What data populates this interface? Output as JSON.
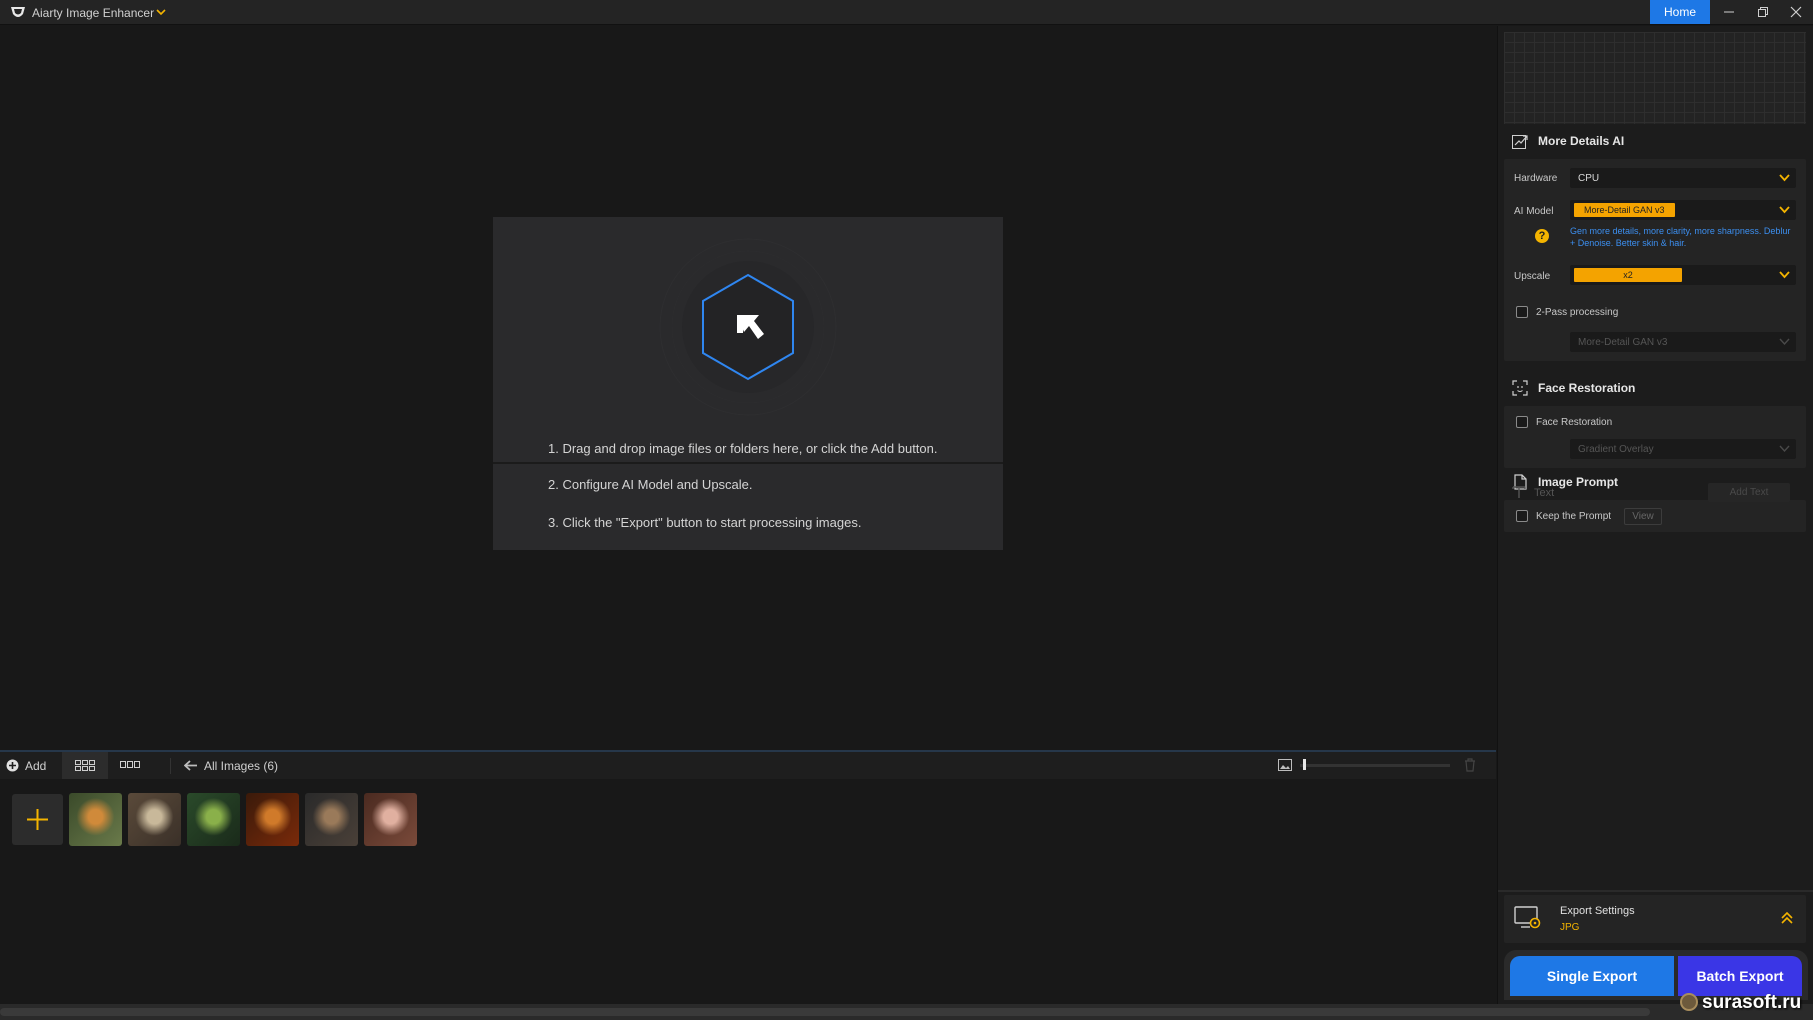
{
  "app": {
    "title": "Aiarty Image Enhancer",
    "home_label": "Home"
  },
  "dropzone": {
    "steps": [
      "1. Drag and drop image files or folders here, or click the Add button.",
      "2. Configure AI Model and Upscale.",
      "3. Click the \"Export\" button to start processing images."
    ]
  },
  "toolbar": {
    "add_label": "Add",
    "all_images_label": "All Images (6)",
    "thumbnail_size": 0.02
  },
  "thumbnails": [
    {
      "name": "tiger",
      "colors": [
        "#3a4a2a",
        "#d08a3a",
        "#6a7a4a"
      ]
    },
    {
      "name": "owl",
      "colors": [
        "#5a4a3a",
        "#c8b89a",
        "#3a3028"
      ]
    },
    {
      "name": "frog-forest",
      "colors": [
        "#2a4a2a",
        "#8ab04a",
        "#1a2a1a"
      ]
    },
    {
      "name": "burger",
      "colors": [
        "#3a1a0a",
        "#d07a2a",
        "#7a2a0a"
      ]
    },
    {
      "name": "dog-armor",
      "colors": [
        "#2a2a2a",
        "#9a7a5a",
        "#4a4038"
      ]
    },
    {
      "name": "woman-portrait",
      "colors": [
        "#4a2a20",
        "#e0b0a0",
        "#7a4a3a"
      ]
    }
  ],
  "panel": {
    "more_details": {
      "title": "More Details AI",
      "hardware_label": "Hardware",
      "hardware_value": "CPU",
      "ai_model_label": "AI Model",
      "ai_model_value": "More-Detail GAN  v3",
      "ai_model_description": "Gen more details, more clarity, more sharpness. Deblur + Denoise. Better skin & hair.",
      "help_glyph": "?",
      "upscale_label": "Upscale",
      "upscale_value": "x2",
      "two_pass_label": "2-Pass processing",
      "two_pass_model": "More-Detail GAN  v3"
    },
    "face_restoration": {
      "title": "Face Restoration",
      "checkbox_label": "Face Restoration",
      "model_value": "Gradient Overlay"
    },
    "image_prompt": {
      "title": "Image Prompt",
      "keep_prompt_label": "Keep the Prompt",
      "view_label": "View",
      "text_label": "Text",
      "add_text_label": "Add Text"
    },
    "export": {
      "settings_label": "Export Settings",
      "format": "JPG",
      "single_export_label": "Single Export",
      "batch_export_label": "Batch Export"
    }
  },
  "watermark": {
    "text": "surasoft.ru"
  },
  "colors": {
    "accent_blue": "#1e78e6",
    "accent_yellow": "#f4a300",
    "batch_purple": "#3a36e6",
    "hex_blue": "#2f86f0"
  }
}
